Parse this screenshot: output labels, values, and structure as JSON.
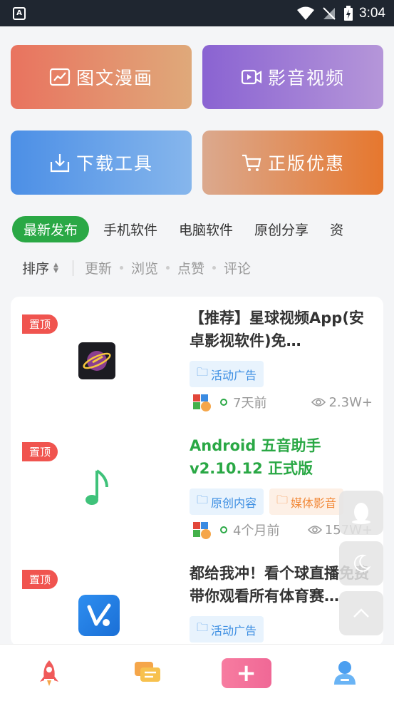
{
  "status_bar": {
    "time": "3:04",
    "app_glyph": "A"
  },
  "tiles": [
    {
      "label": "图文漫画",
      "icon": "chart-frame-icon"
    },
    {
      "label": "影音视频",
      "icon": "video-icon"
    },
    {
      "label": "下载工具",
      "icon": "download-icon"
    },
    {
      "label": "正版优惠",
      "icon": "cart-icon"
    }
  ],
  "categories": [
    "最新发布",
    "手机软件",
    "电脑软件",
    "原创分享",
    "资"
  ],
  "sort": {
    "label": "排序",
    "options": [
      "更新",
      "浏览",
      "点赞",
      "评论"
    ]
  },
  "items": [
    {
      "badge": "置顶",
      "title": "【推荐】星球视频App(安卓影视软件)免…",
      "title_color": "default",
      "tags": [
        {
          "label": "活动广告",
          "style": "blue"
        }
      ],
      "time": "7天前",
      "views": "2.3W+"
    },
    {
      "badge": "置顶",
      "title": "Android 五音助手 v2.10.12 正式版",
      "title_color": "green",
      "tags": [
        {
          "label": "原创内容",
          "style": "blue"
        },
        {
          "label": "媒体影音",
          "style": "orange"
        }
      ],
      "time": "4个月前",
      "views": "157W+"
    },
    {
      "badge": "置顶",
      "title": "都给我冲！看个球直播免费带你观看所有体育赛…",
      "title_color": "default",
      "tags": [
        {
          "label": "活动广告",
          "style": "blue"
        }
      ],
      "time": "",
      "views": ""
    }
  ],
  "colors": {
    "accent_green": "#2aa845",
    "badge_red": "#f0544f",
    "tag_blue": "#3c8ee2",
    "tag_orange": "#f28a3a"
  }
}
